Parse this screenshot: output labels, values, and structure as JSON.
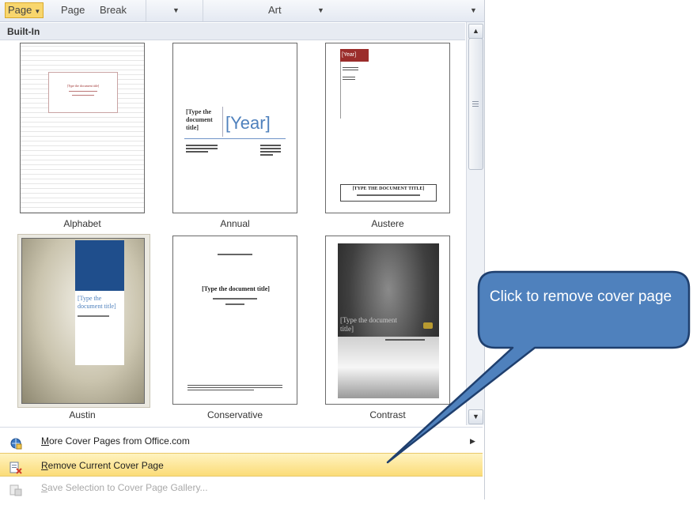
{
  "ribbon": {
    "items": [
      {
        "label": "Page",
        "active": true
      },
      {
        "label": "Page",
        "active": false
      },
      {
        "label": "Break",
        "active": false
      },
      {
        "label": "Art",
        "active": false
      }
    ]
  },
  "gallery": {
    "heading": "Built-In",
    "tiles": [
      {
        "name": "Alphabet",
        "preview_title": "[Type the document title]"
      },
      {
        "name": "Annual",
        "preview_title": "[Type the document title]",
        "preview_year": "[Year]"
      },
      {
        "name": "Austere",
        "preview_title": "[TYPE THE DOCUMENT TITLE]",
        "preview_year": "[Year]"
      },
      {
        "name": "Austin",
        "preview_title": "[Type the document title]"
      },
      {
        "name": "Conservative",
        "preview_title": "[Type the document title]"
      },
      {
        "name": "Contrast",
        "preview_title": "[Type the document title]"
      }
    ]
  },
  "menu": {
    "more_cover_pages": {
      "prefix": "M",
      "label": "ore Cover Pages from Office.com"
    },
    "remove_cover_page": {
      "prefix": "R",
      "label": "emove Current Cover Page"
    },
    "save_selection": {
      "prefix": "S",
      "label": "ave Selection to Cover Page Gallery..."
    }
  },
  "callout": {
    "text": "Click to remove cover page",
    "fill": "#4f81bd",
    "stroke": "#1f3f6e"
  },
  "colors": {
    "highlight": "#fbdc78",
    "accent_red": "#9b2d2b",
    "annual_blue": "#4f81bd",
    "austin_blue": "#1f4e8c"
  }
}
